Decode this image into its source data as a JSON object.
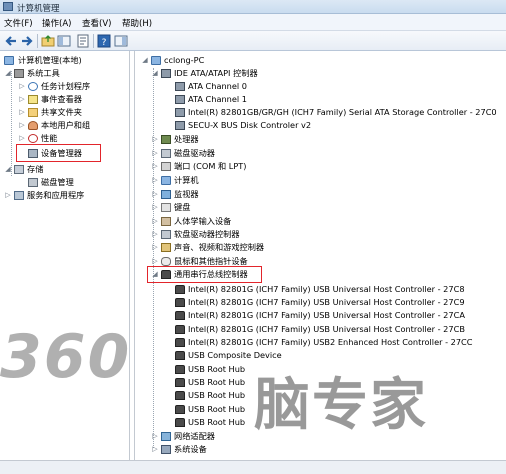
{
  "window": {
    "title": "计算机管理"
  },
  "menu": [
    "文件(F)",
    "操作(A)",
    "查看(V)",
    "帮助(H)"
  ],
  "toolbar_icons": [
    "back-arrow-icon",
    "forward-arrow-icon",
    "up-folder-icon",
    "show-tree-icon",
    "properties-icon",
    "help-icon",
    "console-icon"
  ],
  "left_tree": {
    "root": "计算机管理(本地)",
    "system_tools": "系统工具",
    "items": [
      "任务计划程序",
      "事件查看器",
      "共享文件夹",
      "本地用户和组",
      "性能",
      "设备管理器"
    ],
    "storage": "存储",
    "disk_mgmt": "磁盘管理",
    "services": "服务和应用程序"
  },
  "device_tree": {
    "computer": "cclong-PC",
    "ide": {
      "label": "IDE ATA/ATAPI 控制器",
      "children": [
        "ATA Channel 0",
        "ATA Channel 1",
        "Intel(R) 82801GB/GR/GH (ICH7 Family) Serial ATA Storage Controller - 27C0",
        "SECU-X BUS Disk Controler v2"
      ]
    },
    "categories_a": [
      "处理器",
      "磁盘驱动器",
      "端口 (COM 和 LPT)",
      "计算机",
      "监视器",
      "键盘",
      "人体学输入设备",
      "软盘驱动器控制器",
      "声音、视频和游戏控制器",
      "鼠标和其他指针设备"
    ],
    "usb": {
      "label": "通用串行总线控制器",
      "children": [
        "Intel(R) 82801G (ICH7 Family) USB Universal Host Controller - 27C8",
        "Intel(R) 82801G (ICH7 Family) USB Universal Host Controller - 27C9",
        "Intel(R) 82801G (ICH7 Family) USB Universal Host Controller - 27CA",
        "Intel(R) 82801G (ICH7 Family) USB Universal Host Controller - 27CB",
        "Intel(R) 82801G (ICH7 Family) USB2 Enhanced Host Controller - 27CC",
        "USB Composite Device",
        "USB Root Hub",
        "USB Root Hub",
        "USB Root Hub",
        "USB Root Hub",
        "USB Root Hub"
      ]
    },
    "categories_b": [
      "网络适配器",
      "系统设备"
    ]
  },
  "watermark": {
    "left": "360",
    "right": "脑专家"
  },
  "colors": {
    "highlight_box": "#e2252b",
    "titlebar": "#c9dcef"
  }
}
